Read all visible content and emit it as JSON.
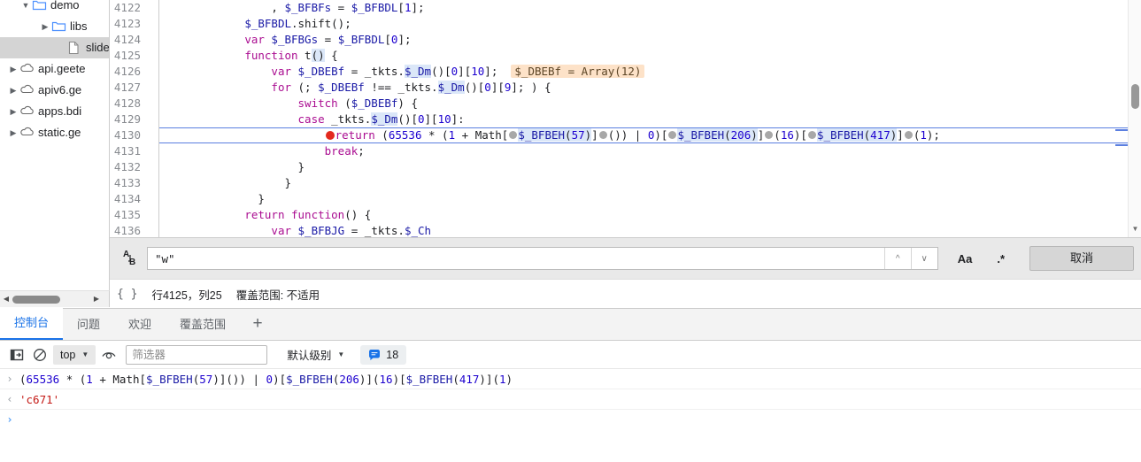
{
  "tree": {
    "items": [
      {
        "label": "demo",
        "icon": "folder-icon",
        "arrow": "▼",
        "depth": 1,
        "selected": false
      },
      {
        "label": "libs",
        "icon": "folder-icon",
        "arrow": "▶",
        "depth": 2,
        "selected": false
      },
      {
        "label": "slide",
        "icon": "file-icon",
        "arrow": "",
        "depth": 3,
        "selected": true
      },
      {
        "label": "api.geete",
        "icon": "cloud-icon",
        "arrow": "▶",
        "depth": 0,
        "selected": false
      },
      {
        "label": "apiv6.ge",
        "icon": "cloud-icon",
        "arrow": "▶",
        "depth": 0,
        "selected": false
      },
      {
        "label": "apps.bdi",
        "icon": "cloud-icon",
        "arrow": "▶",
        "depth": 0,
        "selected": false
      },
      {
        "label": "static.ge",
        "icon": "cloud-icon",
        "arrow": "▶",
        "depth": 0,
        "selected": false
      }
    ]
  },
  "editor": {
    "lines": [
      {
        "num": "4122",
        "fold": false,
        "breakpoint": false,
        "current": false
      },
      {
        "num": "4123",
        "fold": false,
        "breakpoint": false,
        "current": false
      },
      {
        "num": "4124",
        "fold": false,
        "breakpoint": false,
        "current": false
      },
      {
        "num": "4125",
        "fold": true,
        "breakpoint": false,
        "current": false
      },
      {
        "num": "4126",
        "fold": false,
        "breakpoint": false,
        "current": false
      },
      {
        "num": "4127",
        "fold": true,
        "breakpoint": false,
        "current": false
      },
      {
        "num": "4128",
        "fold": true,
        "breakpoint": false,
        "current": false
      },
      {
        "num": "4129",
        "fold": false,
        "breakpoint": false,
        "current": false
      },
      {
        "num": "4130",
        "fold": false,
        "breakpoint": true,
        "current": true
      },
      {
        "num": "4131",
        "fold": false,
        "breakpoint": false,
        "current": false
      },
      {
        "num": "4132",
        "fold": false,
        "breakpoint": false,
        "current": false
      },
      {
        "num": "4133",
        "fold": false,
        "breakpoint": false,
        "current": false
      },
      {
        "num": "4134",
        "fold": false,
        "breakpoint": false,
        "current": false
      },
      {
        "num": "4135",
        "fold": true,
        "breakpoint": false,
        "current": false
      },
      {
        "num": "4136",
        "fold": false,
        "breakpoint": false,
        "current": false
      }
    ],
    "source_text": [
      "                , $_BFBFs = $_BFBDL[1];",
      "            $_BFBDL.shift();",
      "            var $_BFBGs = $_BFBDL[0];",
      "            function t() {",
      "                var $_DBEBf = _tkts.$_Dm()[0][10];   $_DBEBf = Array(12)",
      "                for (; $_DBEBf !== _tkts.$_Dm()[0][9]; ) {",
      "                    switch ($_DBEBf) {",
      "                    case _tkts.$_Dm()[0][10]:",
      "                        return (65536 * (1 + Math[$_BFBEH(57)]()) | 0)[$_BFBEH(206)](16)[$_BFBEH(417)](1);",
      "                        break;",
      "                    }",
      "                  }",
      "              }",
      "            return function() {",
      "                var $_BFBJG = _tkts.$_Ch"
    ],
    "inline_value_hint": "$_DBEBf = Array(12)"
  },
  "findbar": {
    "replace_icon": "replace-icon",
    "query": "\"w\"",
    "placeholder": "",
    "prev_icon": "chevron-up-icon",
    "next_icon": "chevron-down-icon",
    "match_case_label": "Aa",
    "regex_label": ".*",
    "cancel_label": "取消"
  },
  "statusbar": {
    "braces": "{ }",
    "position": "行4125，列25",
    "coverage": "覆盖范围: 不适用"
  },
  "console": {
    "tabs": [
      {
        "label": "控制台",
        "active": true
      },
      {
        "label": "问题",
        "active": false
      },
      {
        "label": "欢迎",
        "active": false
      },
      {
        "label": "覆盖范围",
        "active": false
      }
    ],
    "add_tab_label": "+",
    "toolbar": {
      "sidebar_icon": "console-sidebar-icon",
      "clear_icon": "clear-console-icon",
      "context_value": "top",
      "eye_icon": "live-expression-icon",
      "filter_placeholder": "筛选器",
      "filter_value": "",
      "level_label": "默认级别",
      "message_count": "18",
      "badge_icon": "message-bubble-icon"
    },
    "entries": [
      {
        "kind": "input",
        "arrow": "›",
        "text": "(65536 * (1 + Math[$_BFBEH(57)]()) | 0)[$_BFBEH(206)](16)[$_BFBEH(417)](1)"
      },
      {
        "kind": "result",
        "arrow": "‹",
        "text": "'c671'"
      },
      {
        "kind": "prompt",
        "arrow": "›",
        "text": ""
      }
    ]
  },
  "colors": {
    "accent": "#1a73e8",
    "breakpoint": "#e3291e",
    "current_line_border": "#5b7fe0",
    "inline_value_bg": "#fde2c8",
    "result_text": "#c41a16",
    "keyword": "#aa0d91",
    "number": "#1c00cf",
    "identifier": "#1a1aa6"
  }
}
